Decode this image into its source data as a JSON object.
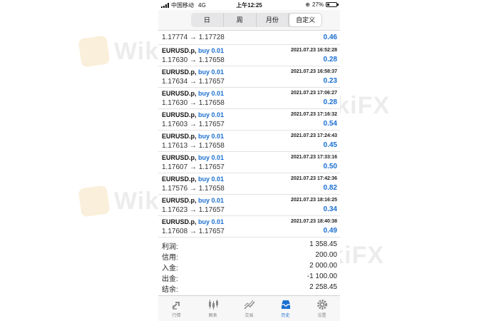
{
  "status_bar": {
    "carrier": "中国移动",
    "network": "4G",
    "time": "上午12:25",
    "battery": "27%"
  },
  "period_tabs": [
    "日",
    "周",
    "月份",
    "自定义"
  ],
  "active_period_index": 3,
  "partial_row": {
    "prices": "1.17774 → 1.17728",
    "profit": "0.46"
  },
  "trades": [
    {
      "symbol": "EURUSD.p,",
      "side": "buy 0.01",
      "time": "2021.07.23 16:52:28",
      "prices": "1.17630 → 1.17658",
      "profit": "0.28"
    },
    {
      "symbol": "EURUSD.p,",
      "side": "buy 0.01",
      "time": "2021.07.23 16:58:37",
      "prices": "1.17634 → 1.17657",
      "profit": "0.23"
    },
    {
      "symbol": "EURUSD.p,",
      "side": "buy 0.01",
      "time": "2021.07.23 17:06:27",
      "prices": "1.17630 → 1.17658",
      "profit": "0.28"
    },
    {
      "symbol": "EURUSD.p,",
      "side": "buy 0.01",
      "time": "2021.07.23 17:16:32",
      "prices": "1.17603 → 1.17657",
      "profit": "0.54"
    },
    {
      "symbol": "EURUSD.p,",
      "side": "buy 0.01",
      "time": "2021.07.23 17:24:43",
      "prices": "1.17613 → 1.17658",
      "profit": "0.45"
    },
    {
      "symbol": "EURUSD.p,",
      "side": "buy 0.01",
      "time": "2021.07.23 17:33:16",
      "prices": "1.17607 → 1.17657",
      "profit": "0.50"
    },
    {
      "symbol": "EURUSD.p,",
      "side": "buy 0.01",
      "time": "2021.07.23 17:42:36",
      "prices": "1.17576 → 1.17658",
      "profit": "0.82"
    },
    {
      "symbol": "EURUSD.p,",
      "side": "buy 0.01",
      "time": "2021.07.23 18:16:25",
      "prices": "1.17623 → 1.17657",
      "profit": "0.34"
    },
    {
      "symbol": "EURUSD.p,",
      "side": "buy 0.01",
      "time": "2021.07.23 18:40:38",
      "prices": "1.17608 → 1.17657",
      "profit": "0.49"
    }
  ],
  "summary": [
    {
      "label": "利润:",
      "value": "1 358.45"
    },
    {
      "label": "信用:",
      "value": "200.00"
    },
    {
      "label": "入金:",
      "value": "2 000.00"
    },
    {
      "label": "出金:",
      "value": "-1 100.00"
    },
    {
      "label": "结余:",
      "value": "2 258.45"
    }
  ],
  "bottom_tabs": [
    {
      "label": "行情",
      "icon": "quotes-icon"
    },
    {
      "label": "图表",
      "icon": "chart-icon"
    },
    {
      "label": "交易",
      "icon": "trade-icon"
    },
    {
      "label": "历史",
      "icon": "history-icon"
    },
    {
      "label": "设置",
      "icon": "settings-icon"
    }
  ],
  "active_bottom_tab_index": 3,
  "watermark_text": "WikiFX",
  "colors": {
    "accent": "#1a6fd1",
    "watermark_logo": "#e9a93a"
  }
}
